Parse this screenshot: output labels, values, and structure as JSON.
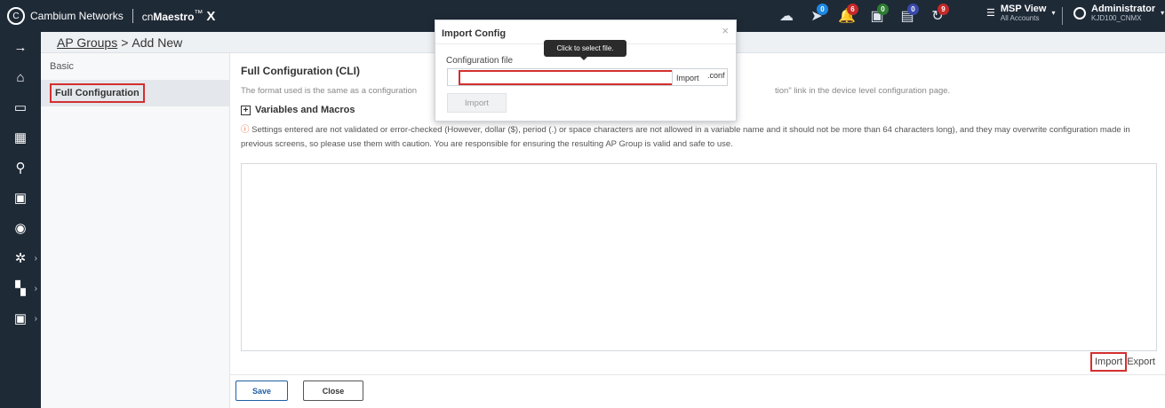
{
  "topbar": {
    "brand": "Cambium Networks",
    "product_prefix": "cn",
    "product_name": "Maestro",
    "product_tm": "™",
    "product_x": "X",
    "icons": [
      {
        "name": "cloud-icon",
        "glyph": "☁",
        "badge": "",
        "badge_color": ""
      },
      {
        "name": "access-point-icon",
        "glyph": "➤",
        "badge": "0",
        "badge_color": "#1e88e5"
      },
      {
        "name": "alarm-bell-icon",
        "glyph": "🔔",
        "badge": "6",
        "badge_color": "#c62828"
      },
      {
        "name": "device-icon",
        "glyph": "▣",
        "badge": "0",
        "badge_color": "#2e7d32"
      },
      {
        "name": "terminal-icon",
        "glyph": "▤",
        "badge": "0",
        "badge_color": "#3949ab"
      },
      {
        "name": "sync-icon",
        "glyph": "↻",
        "badge": "9",
        "badge_color": "#c62828"
      }
    ],
    "msp_title": "MSP View",
    "msp_sub": "All Accounts",
    "admin_title": "Administrator",
    "admin_sub": "KJD100_CNMX"
  },
  "breadcrumb": {
    "parent": "AP Groups",
    "separator": ">",
    "current": "Add New"
  },
  "subnav": {
    "items": [
      {
        "label": "Basic"
      },
      {
        "label": "Full Configuration"
      }
    ]
  },
  "main": {
    "title": "Full Configuration (CLI)",
    "desc_left": "The format used is the same as a configuration",
    "desc_right": "tion\" link in the device level configuration page.",
    "vars_label": "Variables and Macros",
    "warning": "Settings entered are not validated or error-checked (However, dollar ($), period (.) or space characters are not allowed in a variable name and it should not be more than 64 characters long), and they may overwrite configuration made in previous screens, so please use them with caution. You are responsible for ensuring the resulting AP Group is valid and safe to use.",
    "import_label": "Import",
    "export_label": "Export",
    "save_label": "Save",
    "close_label": "Close"
  },
  "modal": {
    "title": "Import Config",
    "close_glyph": "×",
    "config_label": "Configuration file",
    "file_button": "Import",
    "file_ext": ".conf",
    "import_button": "Import",
    "tooltip": "Click to select file."
  }
}
